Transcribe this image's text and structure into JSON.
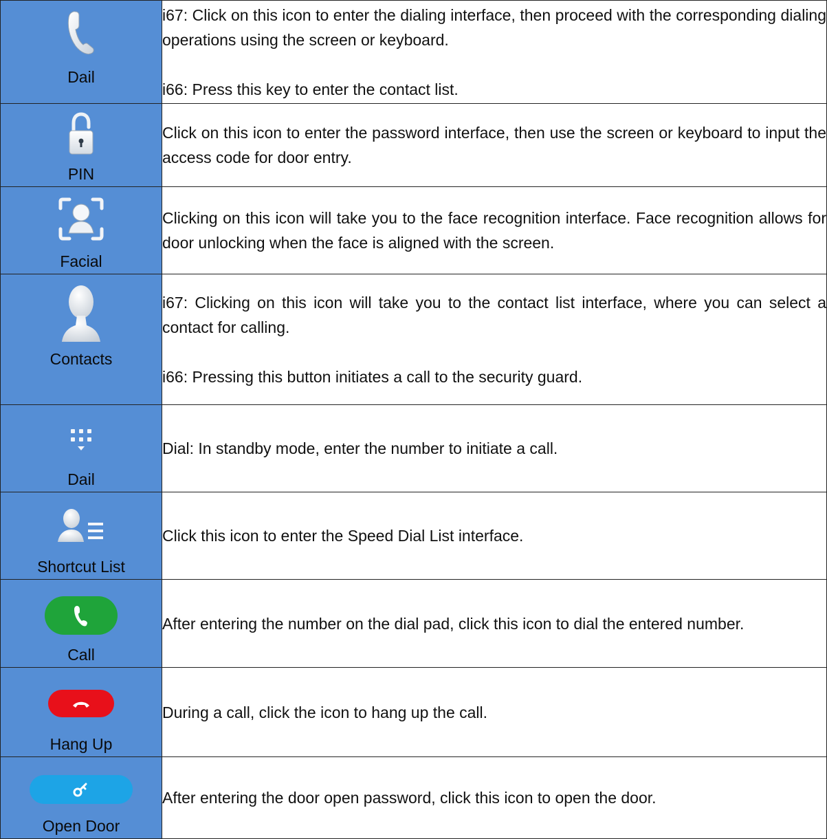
{
  "rows": [
    {
      "icon": "phone-handset-icon",
      "label": "Dail",
      "paragraphs": [
        "i67: Click on this icon to enter the dialing interface, then proceed with the corresponding dialing operations using the screen or keyboard.",
        "i66: Press this key to enter the contact list."
      ]
    },
    {
      "icon": "padlock-icon",
      "label": "PIN",
      "paragraphs": [
        "Click on this icon to enter the password interface, then use the screen or keyboard to input the access code for door entry."
      ]
    },
    {
      "icon": "face-recognition-icon",
      "label": "Facial",
      "paragraphs": [
        "Clicking on this icon will take you to the face recognition interface. Face recognition allows for door unlocking when the face is aligned with the screen."
      ]
    },
    {
      "icon": "contact-person-icon",
      "label": "Contacts",
      "paragraphs": [
        "i67: Clicking on this icon will take you to the contact list interface, where you can select a contact for calling.",
        "i66: Pressing this button initiates a call to the security guard."
      ]
    },
    {
      "icon": "dialpad-icon",
      "label": "Dail",
      "paragraphs": [
        "Dial: In standby mode, enter the number to initiate a call."
      ]
    },
    {
      "icon": "shortcut-list-icon",
      "label": "Shortcut List",
      "paragraphs": [
        "Click this icon to enter the Speed Dial List interface."
      ]
    },
    {
      "icon": "call-button-icon",
      "label": "Call",
      "color": "#1fa43a",
      "paragraphs": [
        "After entering the number on the dial pad, click this icon to dial the entered number."
      ]
    },
    {
      "icon": "hang-up-button-icon",
      "label": "Hang Up",
      "color": "#e8101a",
      "paragraphs": [
        "During a call, click the icon to hang up the call."
      ]
    },
    {
      "icon": "open-door-button-icon",
      "label": "Open Door",
      "color": "#1da4e6",
      "paragraphs": [
        "After entering the door open password, click this icon to open the door."
      ]
    }
  ],
  "colors": {
    "icon_column_bg": "#558ed5",
    "border": "#222222",
    "text": "#111111"
  }
}
